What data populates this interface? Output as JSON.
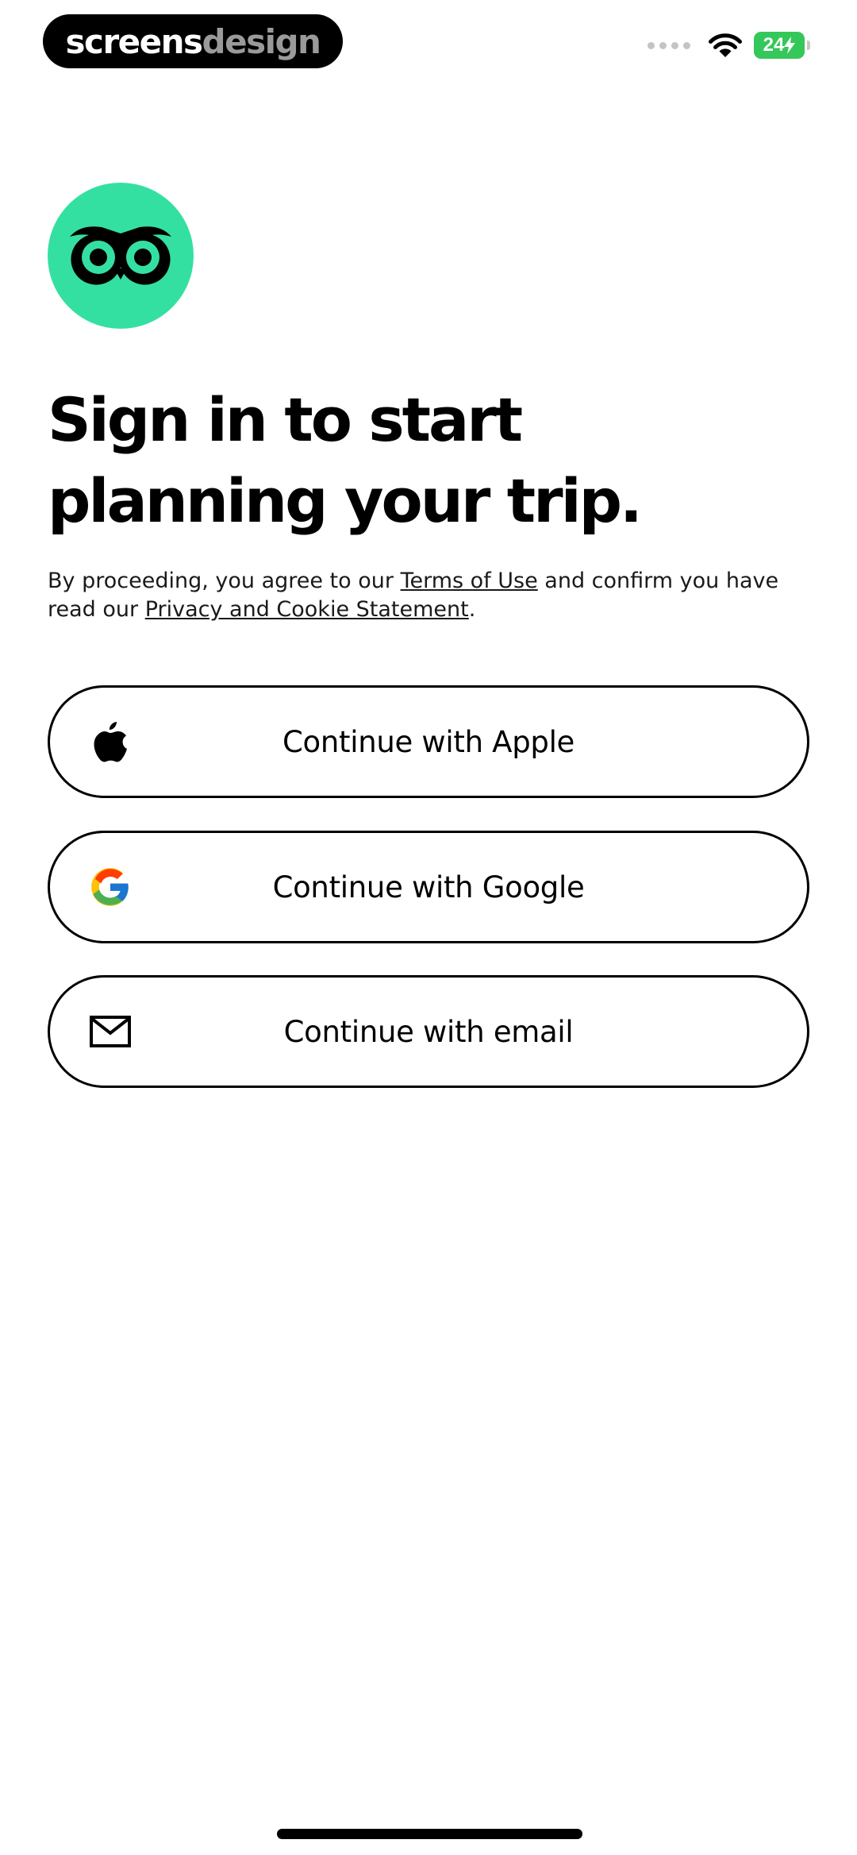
{
  "status_bar": {
    "brand_left": "screens",
    "brand_right": "design",
    "battery": "24",
    "icons": [
      "signal-dots-icon",
      "wifi-icon",
      "battery-charging-icon"
    ]
  },
  "logo": {
    "icon": "owl-eyes-icon",
    "bg_color": "#34e0a1"
  },
  "headline": "Sign in to start planning your trip.",
  "legal": {
    "prefix": "By proceeding, you agree to our ",
    "terms_link": "Terms of Use",
    "middle": " and confirm you have read our ",
    "privacy_link": "Privacy and Cookie Statement",
    "suffix": "."
  },
  "buttons": {
    "apple": {
      "label": "Continue with Apple",
      "icon": "apple-icon"
    },
    "google": {
      "label": "Continue with Google",
      "icon": "google-icon"
    },
    "email": {
      "label": "Continue with email",
      "icon": "mail-icon"
    }
  }
}
